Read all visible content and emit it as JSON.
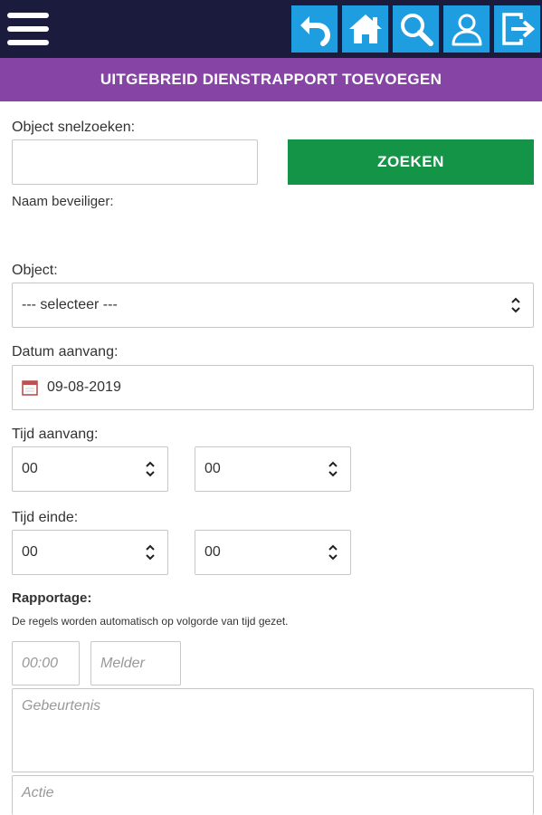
{
  "header": {
    "menu_icon": "hamburger-menu-icon",
    "nav_icons": [
      "back-arrow-icon",
      "home-icon",
      "search-icon",
      "user-icon",
      "logout-icon"
    ],
    "accent_color": "#1e9de0",
    "bar_color": "#1a1b3d"
  },
  "title": {
    "text": "UITGEBREID DIENSTRAPPORT TOEVOEGEN",
    "color": "#8644a5"
  },
  "search": {
    "label": "Object snelzoeken:",
    "value": "",
    "button_label": "ZOEKEN",
    "button_color": "#149447"
  },
  "guard": {
    "label": "Naam beveiliger:",
    "value": ""
  },
  "object": {
    "label": "Object:",
    "selected": "--- selecteer ---"
  },
  "start_date": {
    "label": "Datum aanvang:",
    "value": "09-08-2019",
    "icon": "calendar-icon"
  },
  "start_time": {
    "label": "Tijd aanvang:",
    "hour": "00",
    "minute": "00"
  },
  "end_time": {
    "label": "Tijd einde:",
    "hour": "00",
    "minute": "00"
  },
  "report": {
    "label": "Rapportage:",
    "note": "De regels worden automatisch op volgorde van tijd gezet.",
    "time_placeholder": "00:00",
    "reporter_placeholder": "Melder",
    "event_placeholder": "Gebeurtenis",
    "action_placeholder": "Actie"
  }
}
